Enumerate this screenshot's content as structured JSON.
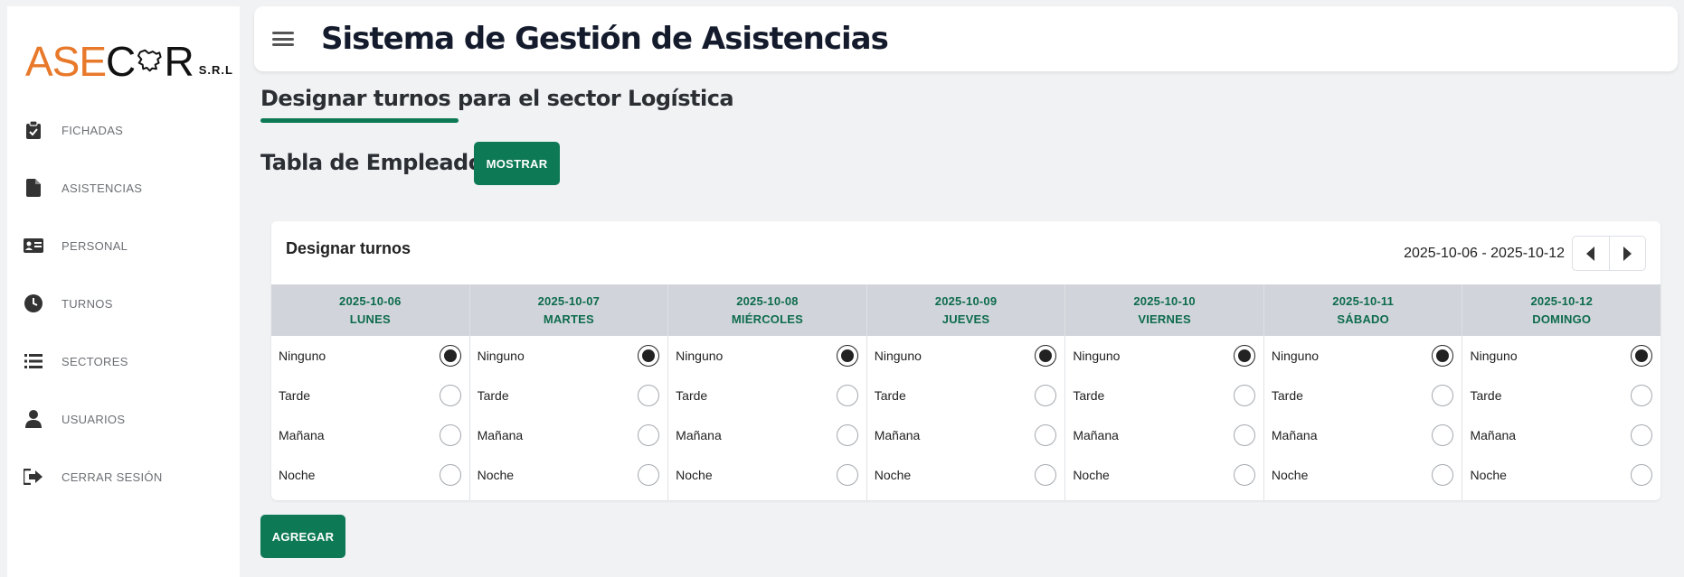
{
  "app": {
    "title": "Sistema de Gestión de Asistencias",
    "logo": {
      "ase": "ASE",
      "c": "C",
      "r": "R",
      "srl": "S.R.L"
    }
  },
  "sidebar": {
    "items": [
      {
        "label": "FICHADAS",
        "icon": "clipboard-check-icon"
      },
      {
        "label": "ASISTENCIAS",
        "icon": "file-icon"
      },
      {
        "label": "PERSONAL",
        "icon": "id-card-icon"
      },
      {
        "label": "TURNOS",
        "icon": "clock-icon"
      },
      {
        "label": "SECTORES",
        "icon": "list-icon"
      },
      {
        "label": "USUARIOS",
        "icon": "user-icon"
      },
      {
        "label": "CERRAR SESIÓN",
        "icon": "logout-icon"
      }
    ]
  },
  "main": {
    "section_title": "Designar turnos para el sector Logística",
    "tabla_title": "Tabla de Empleados",
    "mostrar_label": "MOSTRAR",
    "agregar_label": "AGREGAR"
  },
  "card": {
    "title": "Designar turnos",
    "range": "2025-10-06 - 2025-10-12",
    "days": [
      {
        "date": "2025-10-06",
        "day": "LUNES",
        "selected": "Ninguno"
      },
      {
        "date": "2025-10-07",
        "day": "MARTES",
        "selected": "Ninguno"
      },
      {
        "date": "2025-10-08",
        "day": "MIÉRCOLES",
        "selected": "Ninguno"
      },
      {
        "date": "2025-10-09",
        "day": "JUEVES",
        "selected": "Ninguno"
      },
      {
        "date": "2025-10-10",
        "day": "VIERNES",
        "selected": "Ninguno"
      },
      {
        "date": "2025-10-11",
        "day": "SÁBADO",
        "selected": "Ninguno"
      },
      {
        "date": "2025-10-12",
        "day": "DOMINGO",
        "selected": "Ninguno"
      }
    ],
    "options": [
      "Ninguno",
      "Tarde",
      "Mañana",
      "Noche"
    ]
  },
  "colors": {
    "accent": "#0e7a55",
    "logo_orange": "#e8792b",
    "header_bg": "#d1d5db"
  }
}
